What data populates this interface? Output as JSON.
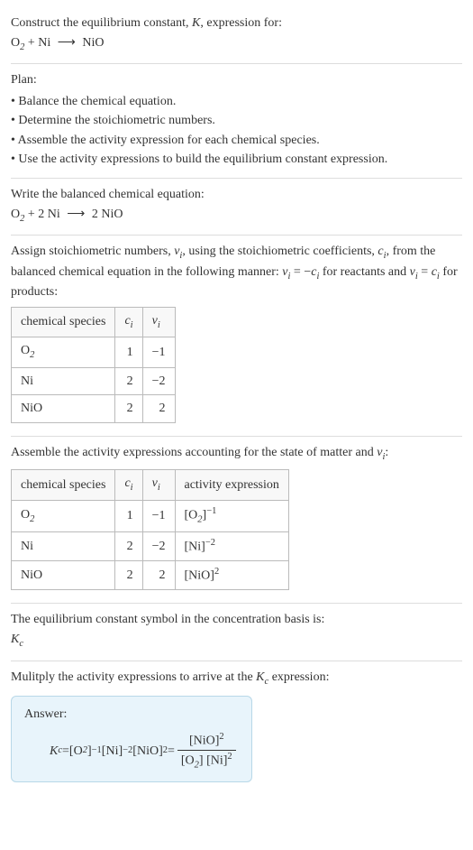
{
  "header": {
    "line1_pre": "Construct the equilibrium constant, ",
    "line1_K": "K",
    "line1_post": ", expression for:",
    "eq_lhs1": "O",
    "eq_lhs1_sub": "2",
    "eq_plus": " + Ni ",
    "eq_arrow": "⟶",
    "eq_rhs": " NiO"
  },
  "plan": {
    "title": "Plan:",
    "b1": "• Balance the chemical equation.",
    "b2": "• Determine the stoichiometric numbers.",
    "b3": "• Assemble the activity expression for each chemical species.",
    "b4": "• Use the activity expressions to build the equilibrium constant expression."
  },
  "balanced": {
    "intro": "Write the balanced chemical equation:",
    "lhs1": "O",
    "lhs1_sub": "2",
    "mid": " + 2 Ni ",
    "arrow": "⟶",
    "rhs": " 2 NiO"
  },
  "stoich": {
    "p1a": "Assign stoichiometric numbers, ",
    "nu": "ν",
    "i": "i",
    "p1b": ", using the stoichiometric coefficients, ",
    "c": "c",
    "p1c": ", from the balanced chemical equation in the following manner: ",
    "rel1a": "ν",
    "rel1b": " = −",
    "rel1c": "c",
    "p1d": " for reactants and ",
    "rel2a": "ν",
    "rel2b": " = ",
    "rel2c": "c",
    "p1e": " for products:",
    "h1": "chemical species",
    "h2a": "c",
    "h3a": "ν",
    "r1s": "O",
    "r1sub": "2",
    "r1c": "1",
    "r1n": "−1",
    "r2s": "Ni",
    "r2c": "2",
    "r2n": "−2",
    "r3s": "NiO",
    "r3c": "2",
    "r3n": "2"
  },
  "activity": {
    "intro_a": "Assemble the activity expressions accounting for the state of matter and ",
    "intro_b": ":",
    "h4": "activity expression",
    "a1_base": "[O",
    "a1_sub": "2",
    "a1_close": "]",
    "a1_exp": "−1",
    "a2_base": "[Ni]",
    "a2_exp": "−2",
    "a3_base": "[NiO]",
    "a3_exp": "2"
  },
  "symbol": {
    "intro": "The equilibrium constant symbol in the concentration basis is:",
    "K": "K",
    "csub": "c"
  },
  "final": {
    "intro_a": "Mulitply the activity expressions to arrive at the ",
    "intro_b": " expression:",
    "answer": "Answer:",
    "Kc_K": "K",
    "Kc_c": "c",
    "eq": " = ",
    "t1": "[O",
    "t1sub": "2",
    "t1close": "]",
    "t1exp": "−1",
    "t2": " [Ni]",
    "t2exp": "−2",
    "t3": " [NiO]",
    "t3exp": "2",
    "eq2": " = ",
    "num": "[NiO]",
    "numexp": "2",
    "den1": "[O",
    "den1sub": "2",
    "den1close": "] [Ni]",
    "den1exp": "2"
  }
}
